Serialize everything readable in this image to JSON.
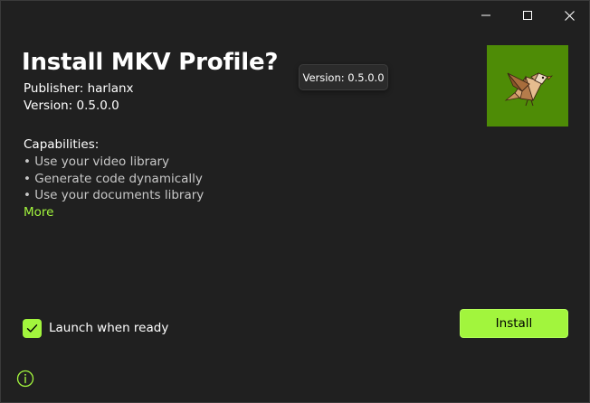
{
  "window": {
    "minimize_icon": "minimize-icon",
    "maximize_icon": "maximize-icon",
    "close_icon": "close-icon"
  },
  "dialog": {
    "title": "Install MKV Profile?",
    "publisher": "Publisher: harlanx",
    "version": "Version: 0.5.0.0",
    "tooltip": "Version: 0.5.0.0",
    "app_logo": "bird-logo",
    "capabilities_heading": "Capabilities:",
    "capabilities": [
      "• Use your video library",
      "• Generate code dynamically",
      "• Use your documents library"
    ],
    "more_link": "More",
    "launch_checkbox": {
      "label": "Launch when ready",
      "checked": true
    },
    "install_button": "Install",
    "info_icon": "info-icon"
  },
  "colors": {
    "background": "#202020",
    "accent": "#a2f53d",
    "logo_tile": "#4e8c06"
  }
}
